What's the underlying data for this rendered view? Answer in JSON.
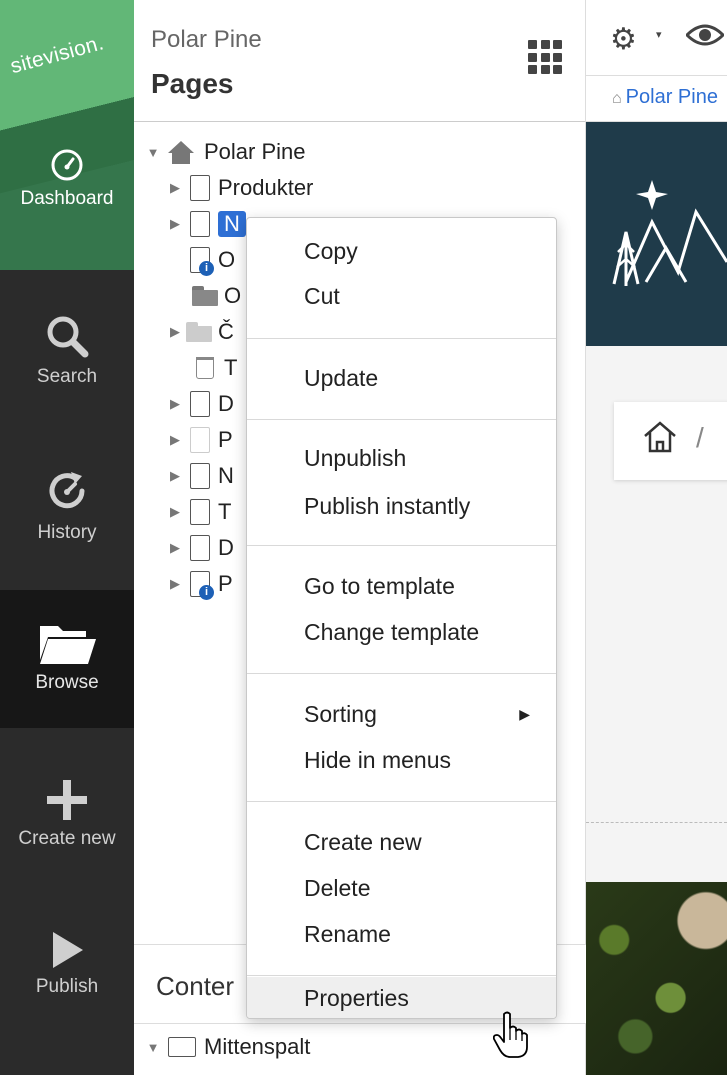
{
  "nav": {
    "logo": "sitevision.",
    "items": [
      {
        "label": "Dashboard",
        "icon": "gauge-icon"
      },
      {
        "label": "Search",
        "icon": "search-icon"
      },
      {
        "label": "History",
        "icon": "history-icon"
      },
      {
        "label": "Browse",
        "icon": "folder-open-icon"
      },
      {
        "label": "Create new",
        "icon": "plus-icon"
      },
      {
        "label": "Publish",
        "icon": "play-icon"
      }
    ]
  },
  "panel": {
    "site_name": "Polar Pine",
    "title": "Pages",
    "content_label": "Conter",
    "tree": {
      "root": "Polar Pine",
      "first_child": "Produkter",
      "selected": "N",
      "truncated_labels": [
        "O",
        "O",
        "Č",
        "T",
        "D",
        "P",
        "N",
        "T",
        "D",
        "P"
      ],
      "content_child": "Mittenspalt"
    }
  },
  "preview": {
    "breadcrumb": "Polar Pine",
    "crumb_sep": "/"
  },
  "context_menu": {
    "groups": [
      [
        "Copy",
        "Cut"
      ],
      [
        "Update"
      ],
      [
        "Unpublish",
        "Publish instantly"
      ],
      [
        "Go to template",
        "Change template"
      ],
      [
        "Sorting",
        "Hide in menus"
      ],
      [
        "Create new",
        "Delete",
        "Rename"
      ],
      [
        "Properties"
      ]
    ],
    "submenu_arrow": "▶",
    "hovered_item": "Properties"
  },
  "colors": {
    "nav_bg": "#2b2b2b",
    "brand_green": "#62b777",
    "selection_blue": "#2e6fd4",
    "info_blue": "#1d60b6",
    "hero_dark": "#1f3b4a"
  }
}
